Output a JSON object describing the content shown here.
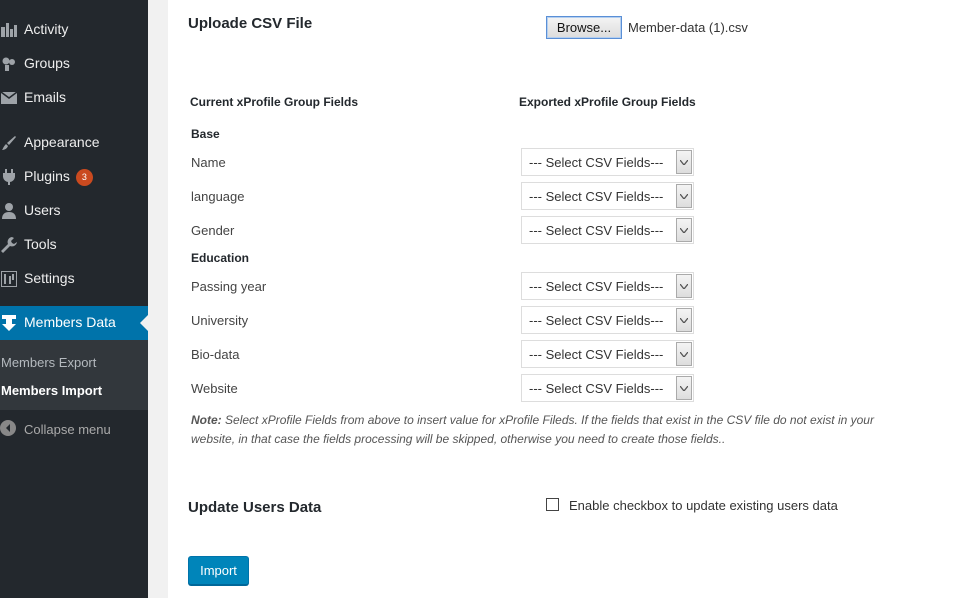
{
  "sidebar": {
    "items": [
      {
        "label": "Activity",
        "icon": "activity-icon"
      },
      {
        "label": "Groups",
        "icon": "groups-icon"
      },
      {
        "label": "Emails",
        "icon": "email-icon"
      },
      {
        "label": "Appearance",
        "icon": "appearance-brush-icon"
      },
      {
        "label": "Plugins",
        "icon": "plugins-icon",
        "badge": "3"
      },
      {
        "label": "Users",
        "icon": "users-icon"
      },
      {
        "label": "Tools",
        "icon": "tools-wrench-icon"
      },
      {
        "label": "Settings",
        "icon": "settings-sliders-icon"
      },
      {
        "label": "Members Data",
        "icon": "members-data-download-icon",
        "active": true
      }
    ],
    "submenu": [
      {
        "label": "Members Export"
      },
      {
        "label": "Members Import",
        "current": true
      }
    ],
    "collapse_label": "Collapse menu"
  },
  "upload": {
    "title": "Uploade CSV File",
    "browse_label": "Browse...",
    "file_name": "Member-data (1).csv"
  },
  "mapping": {
    "current_heading": "Current xProfile Group Fields",
    "exported_heading": "Exported xProfile Group Fields",
    "select_placeholder": "--- Select CSV Fields---",
    "groups": [
      {
        "name": "Base",
        "fields": [
          "Name",
          "language",
          "Gender"
        ]
      },
      {
        "name": "Education",
        "fields": [
          "Passing year",
          "University",
          "Bio-data",
          "Website"
        ]
      }
    ]
  },
  "note": {
    "prefix": "Note:",
    "text": "Select xProfile Fields from above to insert value for xProfile Fileds. If the fields that exist in the CSV file do not exist in your website, in that case the fields processing will be skipped, otherwise you need to create those fields.."
  },
  "update": {
    "title": "Update Users Data",
    "checkbox_label": "Enable checkbox to update existing users data",
    "checked": false
  },
  "import_label": "Import",
  "colors": {
    "sidebar_bg": "#23282d",
    "active_bg": "#0073aa",
    "primary_button": "#0085ba",
    "badge": "#ca4a1f"
  }
}
